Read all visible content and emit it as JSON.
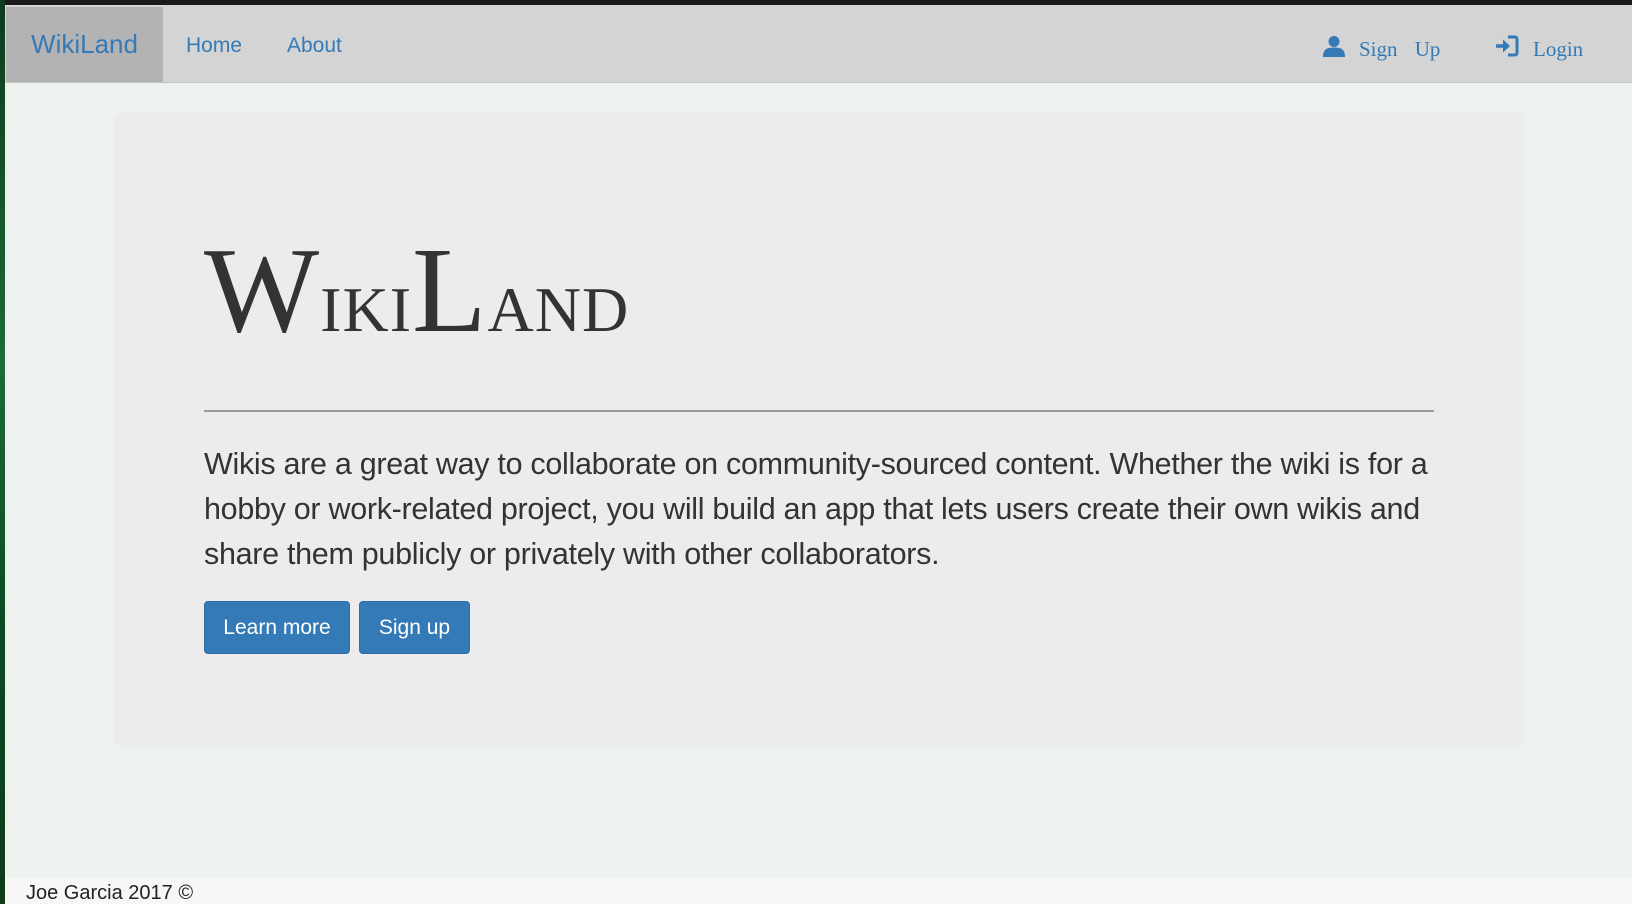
{
  "navbar": {
    "brand": "WikiLand",
    "links": [
      "Home",
      "About"
    ],
    "signup": "Sign Up",
    "login": "Login"
  },
  "hero": {
    "title_first": "W",
    "title_rest1": "iki",
    "title_cap2": "L",
    "title_rest2": "and",
    "text": "Wikis are a great way to collaborate on community-sourced content. Whether the wiki is for a hobby or work-related project, you will build an app that lets users create their own wikis and share them publicly or privately with other collaborators.",
    "buttons": {
      "learn_more": "Learn more",
      "sign_up": "Sign up"
    }
  },
  "footer": {
    "text": "Joe Garcia 2017 ©"
  },
  "colors": {
    "link": "#337ab7",
    "navbar_bg": "#d4d4d4",
    "brand_bg": "#b3b3b3",
    "jumbotron_bg": "#ececec",
    "page_bg": "#eef2ee"
  },
  "icons": [
    "user-icon",
    "login-icon"
  ]
}
